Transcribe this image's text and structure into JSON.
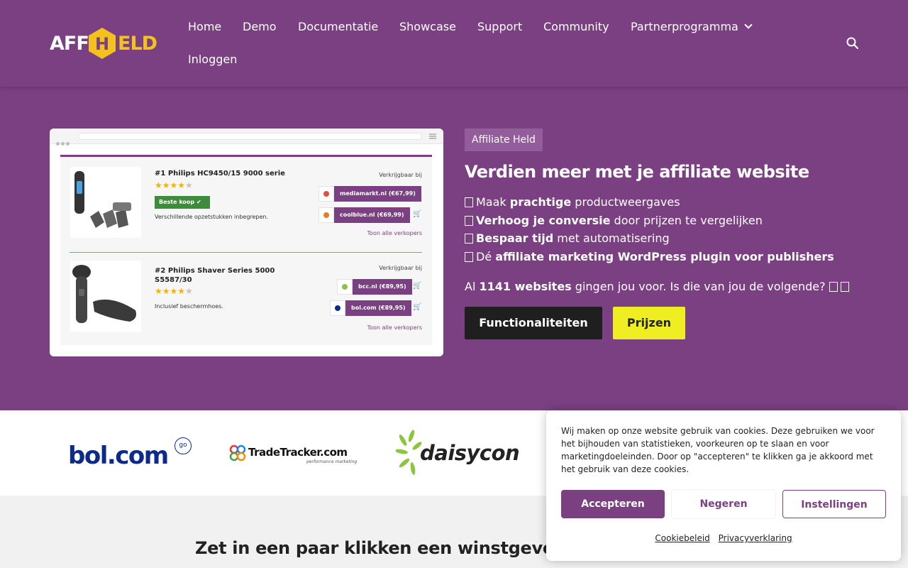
{
  "header": {
    "logo": {
      "part1": "AFF",
      "hex_letter": "H",
      "part2": "ELD"
    },
    "nav": [
      {
        "label": "Home"
      },
      {
        "label": "Demo"
      },
      {
        "label": "Documentatie"
      },
      {
        "label": "Showcase"
      },
      {
        "label": "Support"
      },
      {
        "label": "Community"
      },
      {
        "label": "Partnerprogramma",
        "has_dropdown": true
      },
      {
        "label": "Inloggen"
      }
    ],
    "search_icon": "search-icon"
  },
  "hero": {
    "mockup": {
      "products": [
        {
          "title": "#1 Philips HC9450/15 9000 serie",
          "rating": 4,
          "badge": "Beste koop",
          "description": "Verschillende opzetstukken inbegrepen.",
          "availability": "Verkrijgbaar bij",
          "offers": [
            {
              "shop": "mediamarkt.nl (€67,99)",
              "color": "#e74c3c"
            },
            {
              "shop": "coolblue.nl (€69,99)",
              "color": "#e67e22"
            }
          ],
          "all_sellers": "Toon alle verkopers"
        },
        {
          "title": "#2 Philips Shaver Series 5000 S5587/30",
          "rating": 4,
          "description": "Inclusief beschermhoes.",
          "availability": "Verkrijgbaar bij",
          "offers": [
            {
              "shop": "bcc.nl (€89,95)",
              "color": "#8bc34a"
            },
            {
              "shop": "bol.com (€89,95)",
              "color": "#0b2a8c"
            }
          ],
          "all_sellers": "Toon alle verkopers"
        }
      ]
    },
    "badge": "Affiliate Held",
    "title": "Verdien meer met je affiliate website",
    "features": [
      {
        "pre": "Maak ",
        "bold": "prachtige",
        "post": " productweergaves"
      },
      {
        "pre": "",
        "bold": "Verhoog je conversie",
        "post": " door prijzen te vergelijken"
      },
      {
        "pre": "",
        "bold": "Bespaar tijd",
        "post": " met automatisering"
      },
      {
        "pre": "Dé ",
        "bold": "affiliate marketing WordPress plugin voor publishers",
        "post": ""
      }
    ],
    "websites": {
      "pre": "Al ",
      "bold": "1141 websites",
      "post": " gingen jou voor. Is die van jou de volgende?"
    },
    "btn_features": "Functionaliteiten",
    "btn_prices": "Prijzen"
  },
  "partners": {
    "bol": "bol.com",
    "bol_sub": "go",
    "tradetracker": "TradeTracker.com",
    "tradetracker_sub": "performance marketing",
    "daisycon": "daisycon"
  },
  "section_title": "Zet in een paar klikken een winstgevende a",
  "cookie": {
    "text": "Wij maken op onze website gebruik van cookies. Deze gebruiken we voor het bijhouden van statistieken, voorkeuren op te slaan en voor marketingdoeleinden. Door op \"accepteren\" te klikken ga je akkoord met het gebruik van deze cookies.",
    "accept": "Accepteren",
    "deny": "Negeren",
    "settings": "Instellingen",
    "link_cookie": "Cookiebeleid",
    "link_privacy": "Privacyverklaring"
  },
  "colors": {
    "brand_purple": "#7b4082",
    "yellow": "#eeee22",
    "logo_yellow": "#f4c21d"
  }
}
